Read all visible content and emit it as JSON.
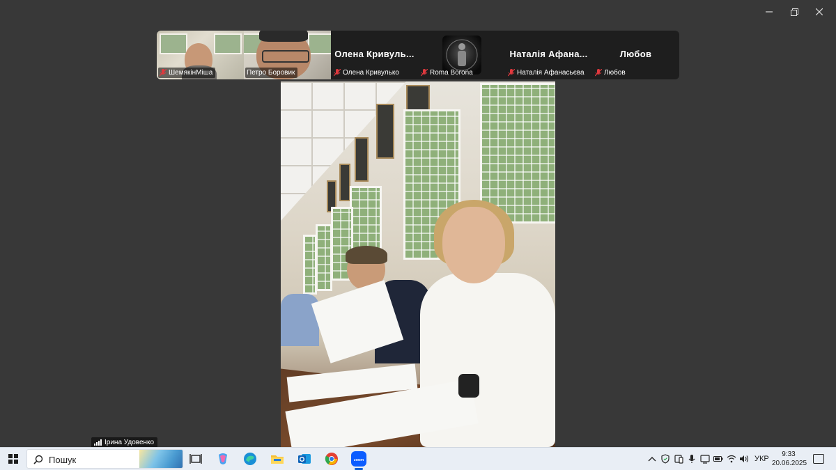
{
  "window": {
    "minimize_icon": "minimize-icon",
    "restore_icon": "restore-icon",
    "close_icon": "close-icon"
  },
  "gallery": {
    "participants": [
      {
        "label": "ШемякінМіша",
        "has_video": true,
        "muted": true
      },
      {
        "label": "Петро Боровик",
        "has_video": true,
        "muted": false
      },
      {
        "label": "Олена Кривулько",
        "display_name": "Олена  Кривуль...",
        "has_video": false,
        "muted": true
      },
      {
        "label": "Roma Borona",
        "has_video": false,
        "has_avatar": true,
        "muted": true
      },
      {
        "label": "Наталія Афанасьєва",
        "display_name": "Наталія  Афана...",
        "has_video": false,
        "muted": true
      },
      {
        "label": "Любов",
        "display_name": "Любов",
        "has_video": false,
        "muted": true
      }
    ]
  },
  "main_video": {
    "self_label": "Ірина Удовенко"
  },
  "taskbar": {
    "search_placeholder": "Пошук",
    "pinned_apps": [
      "task-view",
      "copilot",
      "edge",
      "file-explorer",
      "outlook",
      "chrome",
      "zoom"
    ],
    "active_app": "zoom",
    "language": "УКР",
    "time": "9:33",
    "date": "20.06.2025"
  },
  "colors": {
    "background": "#383838",
    "strip": "#1e1e1e",
    "taskbar": "#e9eef5",
    "muted_mic": "#e0393e",
    "accent": "#0a5fd6"
  }
}
